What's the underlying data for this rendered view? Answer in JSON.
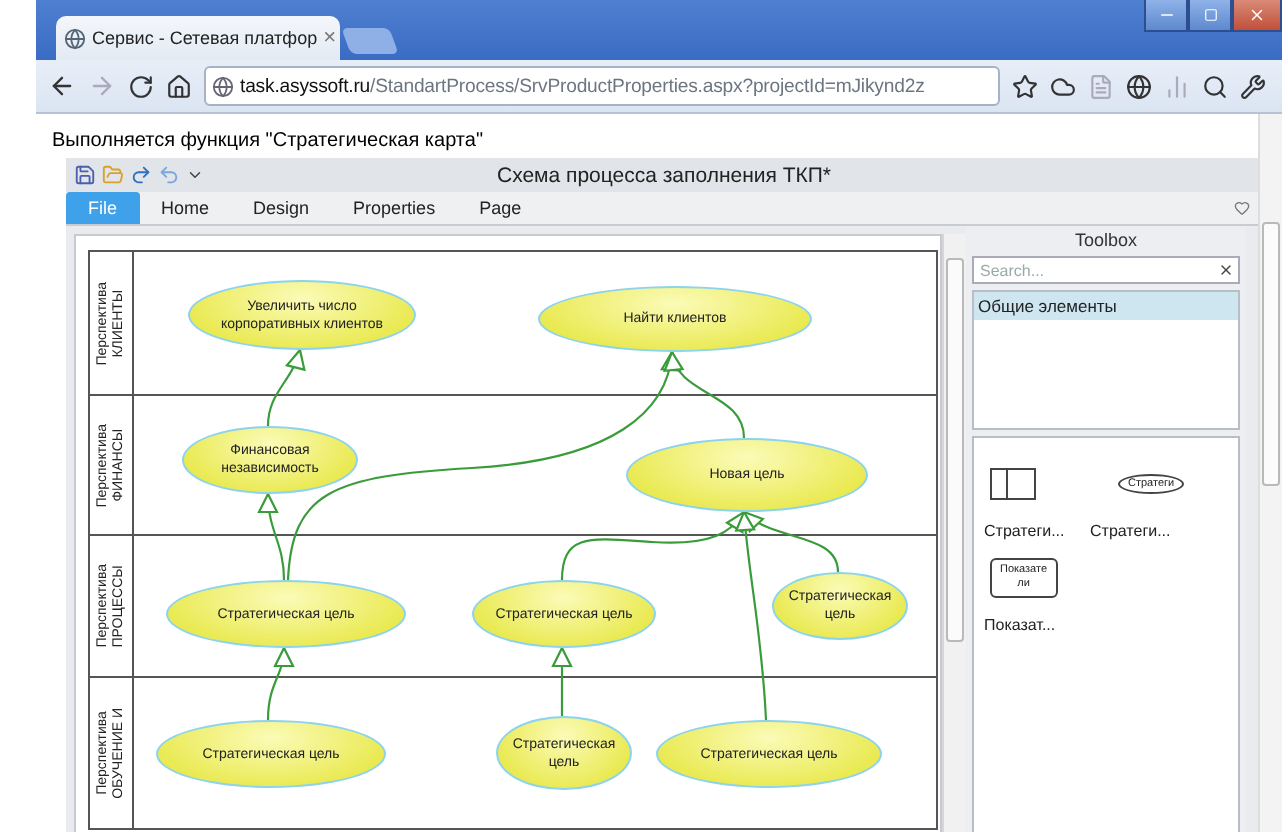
{
  "browser": {
    "tab": {
      "title": "Сервис - Сетевая платфор",
      "close": "×"
    },
    "url": {
      "host": "task.asyssoft.ru",
      "path": "/StandartProcess/SrvProductProperties.aspx?projectId=mJikynd2z"
    }
  },
  "page": {
    "status": "Выполняется функция \"Стратегическая карта\""
  },
  "app": {
    "title": "Схема процесса заполнения ТКП*",
    "ribbon_tabs": [
      {
        "label": "File",
        "selected": true
      },
      {
        "label": "Home",
        "selected": false
      },
      {
        "label": "Design",
        "selected": false
      },
      {
        "label": "Properties",
        "selected": false
      },
      {
        "label": "Page",
        "selected": false
      }
    ]
  },
  "diagram": {
    "lanes": [
      {
        "label": [
          "Перспектива",
          "КЛИЕНТЫ"
        ],
        "nodes": [
          "Увеличить число корпоративных клиентов",
          "Найти клиентов"
        ]
      },
      {
        "label": [
          "Перспектива",
          "ФИНАНСЫ"
        ],
        "nodes": [
          "Финансовая независимость",
          "Новая цель"
        ]
      },
      {
        "label": [
          "Перспектива",
          "ПРОЦЕССЫ"
        ],
        "nodes": [
          "Стратегическая цель",
          "Стратегическая цель",
          "Стратегическая цель"
        ]
      },
      {
        "label": [
          "Перспектива",
          "ОБУЧЕНИЕ И"
        ],
        "nodes": [
          "Стратегическая цель",
          "Стратегическая цель",
          "Стратегическая цель"
        ]
      }
    ]
  },
  "toolbox": {
    "title": "Toolbox",
    "search": {
      "placeholder": "Search..."
    },
    "categories": [
      {
        "label": "Общие элементы",
        "selected": true
      }
    ],
    "items": [
      {
        "kind": "lane",
        "caption": "Стратеги..."
      },
      {
        "kind": "goal",
        "shape_text": [
          "Стратеги"
        ],
        "caption": "Стратеги..."
      },
      {
        "kind": "indicator",
        "shape_text": [
          "Показате",
          "ли"
        ],
        "caption": "Показат..."
      }
    ]
  }
}
